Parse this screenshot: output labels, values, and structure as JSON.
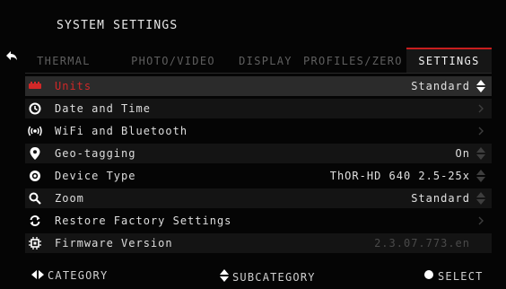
{
  "header": {
    "title": "SYSTEM SETTINGS"
  },
  "tabs": [
    {
      "label": "THERMAL",
      "active": false
    },
    {
      "label": "PHOTO/VIDEO",
      "active": false
    },
    {
      "label": "DISPLAY",
      "active": false
    },
    {
      "label": "PROFILES/ZERO",
      "active": false
    },
    {
      "label": "SETTINGS",
      "active": true
    }
  ],
  "rows": [
    {
      "label": "Units",
      "value": "Standard",
      "control": "updown",
      "selected": true,
      "icon": "units-icon"
    },
    {
      "label": "Date and Time",
      "value": "",
      "control": "chevron-right",
      "icon": "clock-icon"
    },
    {
      "label": "WiFi and Bluetooth",
      "value": "",
      "control": "chevron-right",
      "icon": "wifi-icon"
    },
    {
      "label": "Geo-tagging",
      "value": "On",
      "control": "updown",
      "icon": "location-pin-icon"
    },
    {
      "label": "Device Type",
      "value": "ThOR-HD 640 2.5-25x",
      "control": "updown",
      "icon": "device-icon"
    },
    {
      "label": "Zoom",
      "value": "Standard",
      "control": "updown",
      "icon": "zoom-icon"
    },
    {
      "label": "Restore Factory Settings",
      "value": "",
      "control": "chevron-right",
      "icon": "restore-icon"
    },
    {
      "label": "Firmware Version",
      "value": "2.3.07.773.en",
      "control": "none",
      "icon": "chip-icon"
    }
  ],
  "footer": {
    "category": "CATEGORY",
    "subcategory": "SUBCATEGORY",
    "select": "SELECT"
  },
  "colors": {
    "accent": "#c81e1e",
    "selected_text": "#d02828"
  }
}
